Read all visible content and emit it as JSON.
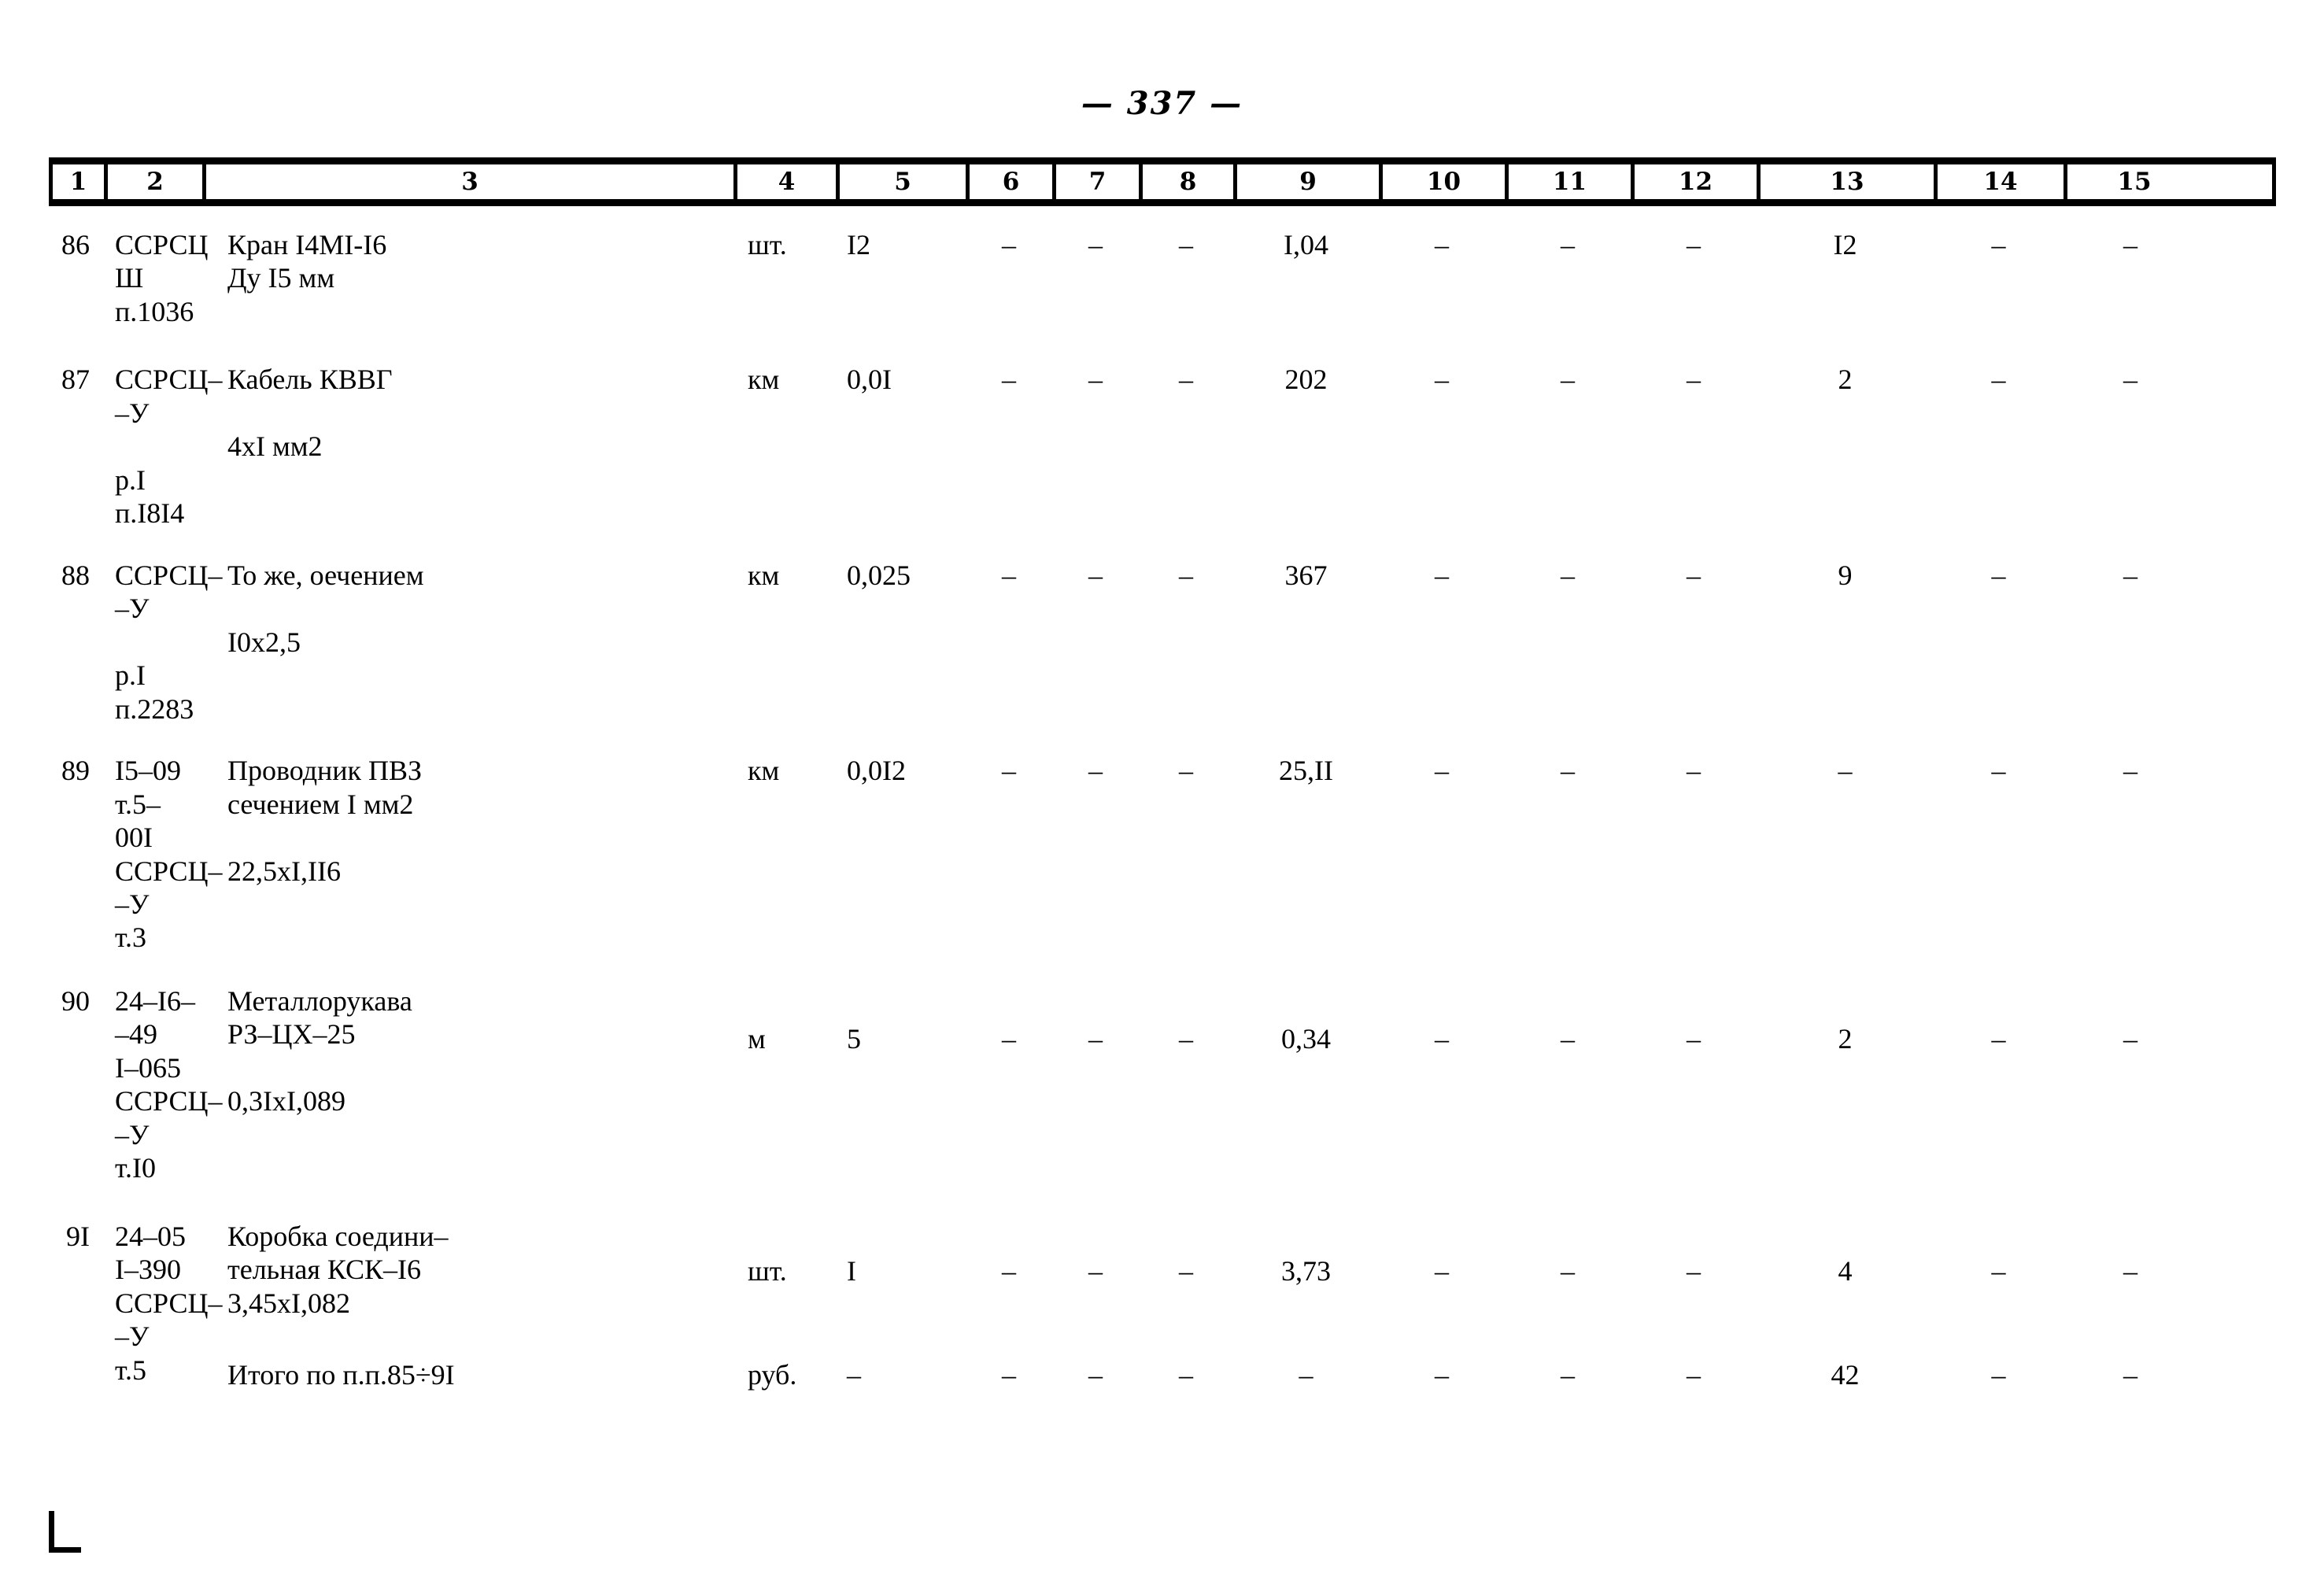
{
  "document": {
    "page_number": "— 337 —",
    "title_row_label": "column-number-header"
  },
  "table": {
    "column_numbers": [
      "1",
      "2",
      "3",
      "4",
      "5",
      "6",
      "7",
      "8",
      "9",
      "10",
      "11",
      "12",
      "13",
      "14",
      "15"
    ],
    "rows": [
      {
        "n": "86",
        "code": "ССРСЦ\nШ\nп.1036",
        "description": "Кран I4MI-I6\nДу I5 мм",
        "unit": "шт.",
        "c5": "I2",
        "c6": "–",
        "c7": "–",
        "c8": "–",
        "c9": "I,04",
        "c10": "–",
        "c11": "–",
        "c12": "–",
        "c13": "I2",
        "c14": "–",
        "c15": "–"
      },
      {
        "n": "87",
        "code": "ССРСЦ–\n–У\n\nр.I\nп.I8I4",
        "description": "Кабель КВВГ\n\n  4хI мм2",
        "unit": "км",
        "c5": "0,0I",
        "c6": "–",
        "c7": "–",
        "c8": "–",
        "c9": "202",
        "c10": "–",
        "c11": "–",
        "c12": "–",
        "c13": "2",
        "c14": "–",
        "c15": "–"
      },
      {
        "n": "88",
        "code": "ССРСЦ–\n–У\n\nр.I\nп.2283",
        "description": "То же, оечением\n\nI0х2,5",
        "unit": "км",
        "c5": "0,025",
        "c6": "–",
        "c7": "–",
        "c8": "–",
        "c9": "367",
        "c10": "–",
        "c11": "–",
        "c12": "–",
        "c13": "9",
        "c14": "–",
        "c15": "–"
      },
      {
        "n": "89",
        "code": "I5–09\nт.5–\n00I\nССРСЦ–\n–У\nт.3",
        "description": "Проводник ПВЗ\nсечением I мм2\n\n22,5хI,II6",
        "unit": "км",
        "c5": "0,0I2",
        "c6": "–",
        "c7": "–",
        "c8": "–",
        "c9": "25,II",
        "c10": "–",
        "c11": "–",
        "c12": "–",
        "c13": "–",
        "c14": "–",
        "c15": "–"
      },
      {
        "n": "90",
        "code": "24–I6–\n–49\nI–065\nССРСЦ–\n–У\nт.I0",
        "description": "Металлорукава\nРЗ–ЦХ–25\n\n0,3IхI,089",
        "unit": "м",
        "c5": "5",
        "c6": "–",
        "c7": "–",
        "c8": "–",
        "c9": "0,34",
        "c10": "–",
        "c11": "–",
        "c12": "–",
        "c13": "2",
        "c14": "–",
        "c15": "–"
      },
      {
        "n": "9I",
        "code": "24–05\nI–390\nССРСЦ–\n–У\nт.5",
        "description": "Коробка соедини–\nтельная КСК–I6\n  3,45хI,082",
        "unit": "шт.",
        "c5": "I",
        "c6": "–",
        "c7": "–",
        "c8": "–",
        "c9": "3,73",
        "c10": "–",
        "c11": "–",
        "c12": "–",
        "c13": "4",
        "c14": "–",
        "c15": "–"
      }
    ],
    "total_row": {
      "n": "",
      "code": "",
      "description": "Итого по п.п.85÷9I",
      "unit": "руб.",
      "c5": "–",
      "c6": "–",
      "c7": "–",
      "c8": "–",
      "c9": "–",
      "c10": "–",
      "c11": "–",
      "c12": "–",
      "c13": "42",
      "c14": "–",
      "c15": "–"
    }
  }
}
